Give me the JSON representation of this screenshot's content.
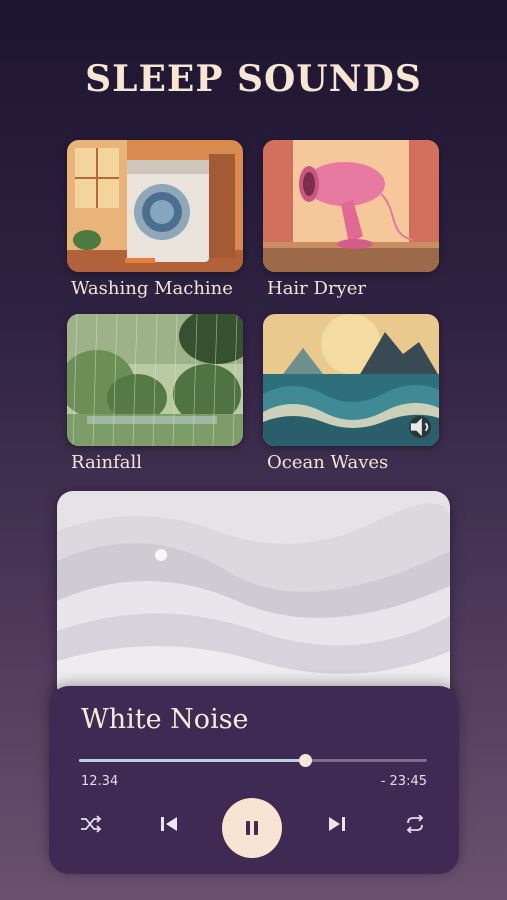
{
  "header": {
    "title": "SLEEP SOUNDS"
  },
  "sounds": [
    {
      "label": "Washing Machine"
    },
    {
      "label": "Hair Dryer"
    },
    {
      "label": "Rainfall"
    },
    {
      "label": "Ocean Waves"
    }
  ],
  "player": {
    "title": "White Noise",
    "elapsed": "12.34",
    "remaining": "- 23:45",
    "progress": 0.65,
    "controls": [
      "shuffle-icon",
      "previous-icon",
      "pause-icon",
      "next-icon",
      "repeat-icon"
    ]
  },
  "colors": {
    "accent": "#f8e4d2",
    "progress": "#b9d2e0",
    "panel": "#3e2a52"
  }
}
